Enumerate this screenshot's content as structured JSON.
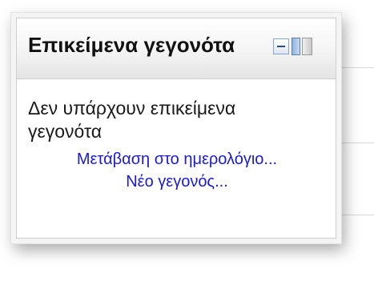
{
  "block": {
    "title": "Επικείμενα γεγονότα",
    "empty_message": "Δεν υπάρχουν επικείμενα γεγονότα",
    "links": {
      "calendar": "Μετάβαση στο ημερολόγιο...",
      "new_event": "Νέο γεγονός..."
    },
    "controls": {
      "collapse_icon": "minus-icon",
      "dock_icon": "dock-icon"
    }
  },
  "colors": {
    "link": "#1a1ad6",
    "text": "#1a1a1a",
    "header_gradient_end": "#e4e4e4"
  }
}
